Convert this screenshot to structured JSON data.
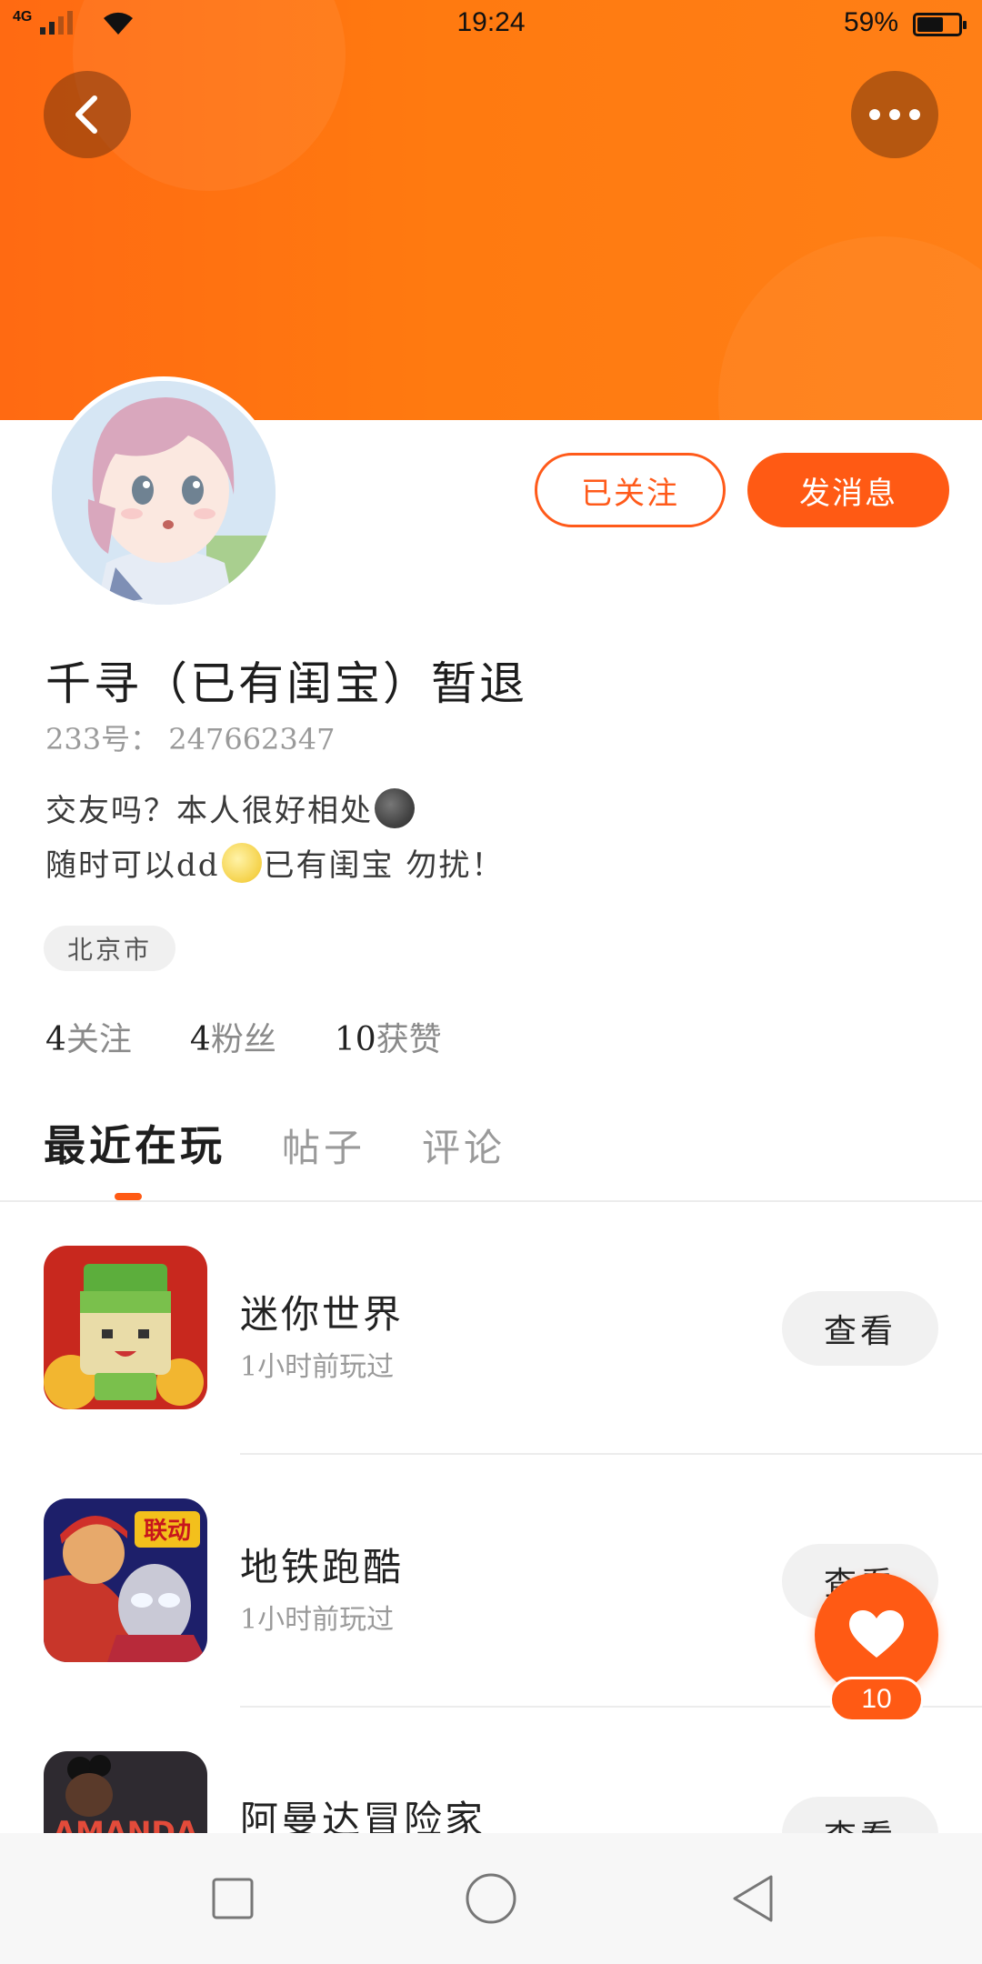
{
  "status_bar": {
    "network": "4G",
    "time": "19:24",
    "battery": "59%"
  },
  "profile": {
    "follow_state_label": "已关注",
    "message_label": "发消息",
    "username": "千寻（已有闺宝）暂退",
    "user_id": "233号：  247662347",
    "bio_line1": "交友吗？本人很好相处",
    "bio_line2_a": "随时可以dd",
    "bio_line2_b": "已有闺宝  勿扰！",
    "location": "北京市",
    "stats": {
      "following_count": "4",
      "following_label": "关注",
      "followers_count": "4",
      "followers_label": "粉丝",
      "likes_count": "10",
      "likes_label": "获赞"
    }
  },
  "tabs": [
    {
      "label": "最近在玩"
    },
    {
      "label": "帖子"
    },
    {
      "label": "评论"
    }
  ],
  "games": [
    {
      "name": "迷你世界",
      "played": "1小时前玩过",
      "button": "查看"
    },
    {
      "name": "地铁跑酷",
      "played": "1小时前玩过",
      "button": "查看"
    },
    {
      "name": "阿曼达冒险家",
      "played": "",
      "button": "查看"
    }
  ],
  "icon_texts": {
    "subway_badge": "联动",
    "amanda_logo": "AMANDA"
  },
  "like_fab": {
    "count": "10"
  },
  "colors": {
    "accent": "#ff5a14",
    "header_gradient_start": "#ff6a12",
    "header_gradient_end": "#ff7f16"
  }
}
